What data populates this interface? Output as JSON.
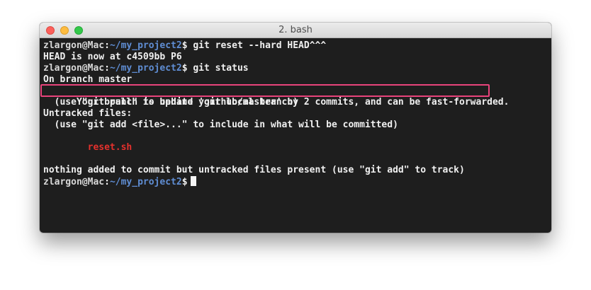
{
  "window": {
    "title": "2. bash"
  },
  "prompt": {
    "user": "zlargon",
    "at": "@",
    "host": "Mac",
    "separator": ":",
    "path": "~/my_project2",
    "dollar": "$"
  },
  "terminal": {
    "cmd1": " git reset --hard HEAD^^^",
    "out1": "HEAD is now at c4509bb P6",
    "cmd2": " git status",
    "out_branch": "On branch master",
    "out_behind": "Your branch is behind 'github/master' by 2 commits, and can be fast-forwarded.",
    "out_pull_hint": "  (use \"git pull\" to update your local branch)",
    "out_untracked_header": "Untracked files:",
    "out_add_hint": "  (use \"git add <file>...\" to include in what will be committed)",
    "untracked_file": "reset.sh",
    "out_nothing_added": "nothing added to commit but untracked files present (use \"git add\" to track)"
  },
  "colors": {
    "highlight_border": "#e8437b",
    "path": "#5f8dd3",
    "untracked_file": "#e5312d",
    "terminal_background": "#1e1e1e"
  }
}
